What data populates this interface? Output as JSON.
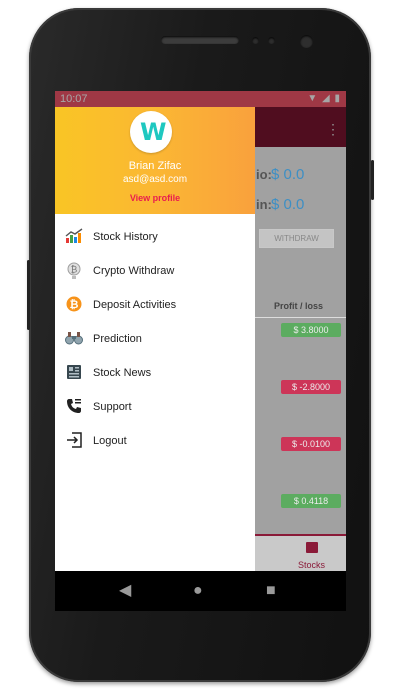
{
  "status_bar": {
    "time": "10:07"
  },
  "drawer": {
    "avatar_letter": "W",
    "user_name": "Brian Zifac",
    "user_email": "asd@asd.com",
    "view_profile": "View profile",
    "items": [
      {
        "label": "Stock History",
        "icon": "chart-icon"
      },
      {
        "label": "Crypto Withdraw",
        "icon": "bitcoin-withdraw-icon"
      },
      {
        "label": "Deposit Activities",
        "icon": "bitcoin-icon"
      },
      {
        "label": "Prediction",
        "icon": "binoculars-icon"
      },
      {
        "label": "Stock News",
        "icon": "newspaper-icon"
      },
      {
        "label": "Support",
        "icon": "phone-support-icon"
      },
      {
        "label": "Logout",
        "icon": "logout-icon"
      }
    ]
  },
  "background_app": {
    "balance_label_1": "io:",
    "balance_value_1": "$ 0.0",
    "balance_label_2": "in:",
    "balance_value_2": "$ 0.0",
    "withdraw_button": "WITHDRAW",
    "column_header": "Profit / loss",
    "rows": [
      {
        "value": "$ 3.8000",
        "color": "#4caf50"
      },
      {
        "value": "$ -2.8000",
        "color": "#d81b47"
      },
      {
        "value": "$ -0.0100",
        "color": "#d81b47"
      },
      {
        "value": "$ 0.4118",
        "color": "#4caf50"
      }
    ],
    "tab_label": "Stocks"
  },
  "colors": {
    "status_bar": "#f5566b",
    "app_bar": "#7c1531",
    "drawer_gradient_start": "#f9c525",
    "drawer_gradient_end": "#f9a13d",
    "accent_pink": "#e91e4f"
  }
}
